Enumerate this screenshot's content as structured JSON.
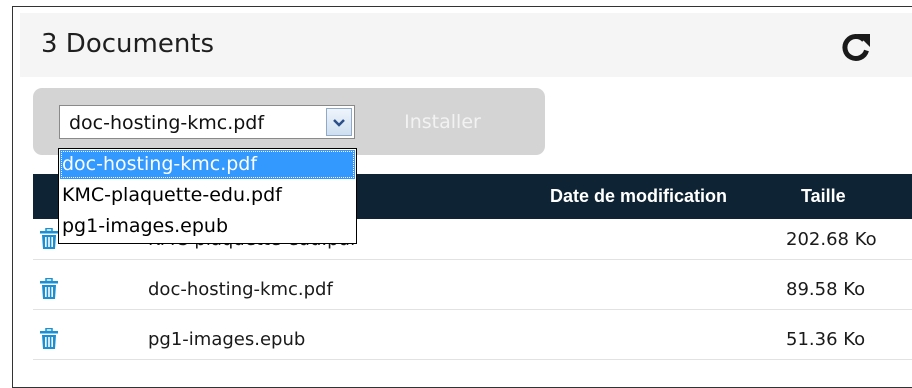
{
  "header": {
    "title": "3 Documents",
    "refresh_icon": "refresh-icon"
  },
  "toolbar": {
    "select_value": "doc-hosting-kmc.pdf",
    "install_label": "Installer"
  },
  "dropdown": {
    "options": [
      "doc-hosting-kmc.pdf",
      "KMC-plaquette-edu.pdf",
      "pg1-images.epub"
    ],
    "selected_index": 0
  },
  "table": {
    "columns": {
      "date": "Date de modification",
      "size": "Taille"
    },
    "rows": [
      {
        "name": "KMC-plaquette-edu.pdf",
        "size": "202.68 Ko"
      },
      {
        "name": "doc-hosting-kmc.pdf",
        "size": "89.58 Ko"
      },
      {
        "name": "pg1-images.epub",
        "size": "51.36 Ko"
      }
    ]
  },
  "colors": {
    "header_bg": "#f5f5f5",
    "table_head_bg": "#0e2333",
    "trash_icon": "#1a8fd1",
    "selection": "#3399ff"
  }
}
